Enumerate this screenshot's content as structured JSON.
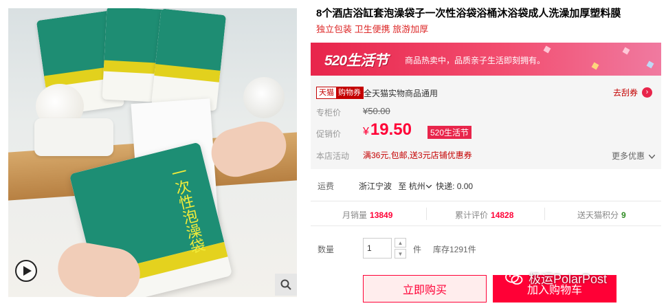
{
  "product": {
    "title": "8个酒店浴缸套泡澡袋子一次性浴袋浴桶沐浴袋成人洗澡加厚塑料膜",
    "subtitle": "独立包装 卫生便携 旅游加厚"
  },
  "gallery": {
    "bag_text": "一次性泡澡袋"
  },
  "banner": {
    "logo": "520生活节",
    "text": "商品热卖中，品质亲子生活即刻拥有。"
  },
  "coupon": {
    "tag_a": "天猫",
    "tag_b": "购物券",
    "desc": "全天猫实物商品通用",
    "action": "去刮券",
    "action_icon": "›"
  },
  "pricing": {
    "original_label": "专柜价",
    "original_price": "¥50.00",
    "promo_label": "促销价",
    "currency": "¥",
    "promo_price": "19.50",
    "event_badge": "520生活节"
  },
  "shop_promo": {
    "label": "本店活动",
    "text": "满36元,包邮,送3元店铺优惠券",
    "more": "更多优惠"
  },
  "shipping": {
    "label": "运费",
    "origin": "浙江宁波",
    "to": "至",
    "destination": "杭州",
    "express": "快递: 0.00"
  },
  "stats": {
    "monthly_sales_label": "月销量",
    "monthly_sales": "13849",
    "reviews_label": "累计评价",
    "reviews": "14828",
    "points_label": "送天猫积分",
    "points": "9"
  },
  "quantity": {
    "label": "数量",
    "value": "1",
    "unit": "件",
    "stock": "库存1291件"
  },
  "actions": {
    "buy_now": "立即购买",
    "add_to_cart": "加入购物车"
  },
  "watermark": {
    "text": "极运PolarPost"
  },
  "colors": {
    "accent_red": "#ff0036",
    "banner_pink": "#e8254b",
    "deep_red": "#c40000",
    "green_points": "#2e8b22",
    "bag_green": "#1d8e74",
    "bag_yellow": "#e4d21e"
  },
  "icons": [
    "play-icon",
    "zoom-icon",
    "chevron-right-icon",
    "chevron-down-icon",
    "caret-up-icon",
    "caret-down-icon",
    "wechat-icon"
  ]
}
